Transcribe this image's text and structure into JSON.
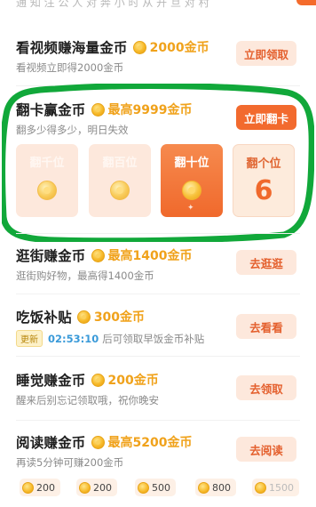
{
  "top_cut_text": "通 知 注 公 人 对 奔 小 时 从 开 旦 对 村",
  "tasks": {
    "video": {
      "title": "看视频赚海量金币",
      "reward": "2000金币",
      "desc": "看视频立即得2000金币",
      "button": "立即领取"
    },
    "flip": {
      "title": "翻卡赢金币",
      "reward": "最高9999金币",
      "desc": "翻多少得多少，明日失效",
      "button": "立即翻卡",
      "cards": [
        {
          "label": "翻千位",
          "state": "faded"
        },
        {
          "label": "翻百位",
          "state": "faded"
        },
        {
          "label": "翻十位",
          "state": "active"
        },
        {
          "label": "翻个位",
          "state": "revealed",
          "digit": "6"
        }
      ]
    },
    "shop": {
      "title": "逛街赚金币",
      "reward": "最高1400金币",
      "desc": "逛街购好物，最高得1400金币",
      "button": "去逛逛"
    },
    "meal": {
      "title": "吃饭补贴",
      "reward": "300金币",
      "badge": "更新",
      "timer": "02:53:10",
      "desc": "后可领取早饭金币补贴",
      "button": "去看看"
    },
    "sleep": {
      "title": "睡觉赚金币",
      "reward": "200金币",
      "desc": "醒来后别忘记领取哦，祝你晚安",
      "button": "去领取"
    },
    "read": {
      "title": "阅读赚金币",
      "reward": "最高5200金币",
      "desc": "再读5分钟可赚200金币",
      "button": "去阅读",
      "chips": [
        "200",
        "200",
        "500",
        "800",
        "1500"
      ]
    }
  },
  "colors": {
    "accent": "#f26a2e",
    "gold": "#f0a21b",
    "ring": "#11a83a"
  }
}
